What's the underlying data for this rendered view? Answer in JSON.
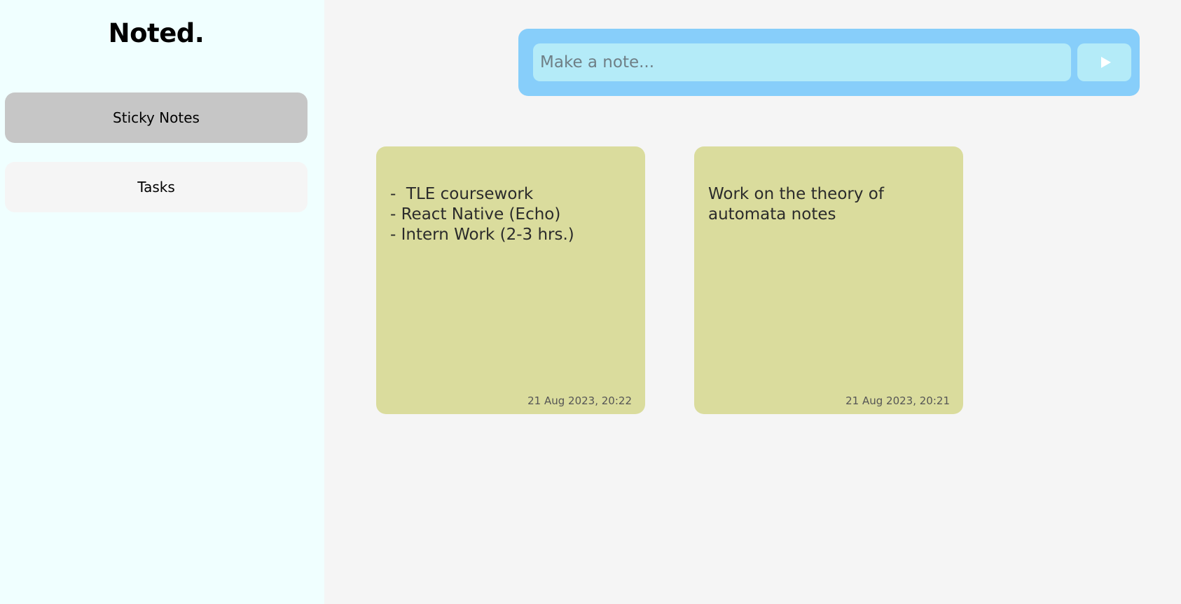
{
  "brand": {
    "title": "Noted."
  },
  "sidebar": {
    "items": [
      {
        "label": "Sticky Notes",
        "active": true
      },
      {
        "label": "Tasks",
        "active": false
      }
    ]
  },
  "composer": {
    "placeholder": "Make a note...",
    "value": "",
    "send_icon": "play-icon"
  },
  "notes": [
    {
      "text": "-  TLE coursework\n- React Native (Echo)\n- Intern Work (2-3 hrs.)",
      "timestamp": "21 Aug 2023, 20:22"
    },
    {
      "text": "Work on the theory of\nautomata notes",
      "timestamp": "21 Aug 2023, 20:21"
    }
  ],
  "colors": {
    "sidebar_bg": "#f0ffff",
    "main_bg": "#f5f5f5",
    "active_nav": "#c6c6c6",
    "composer_bg": "#87cefa",
    "input_bg": "#b4ebf8",
    "note_bg": "#dadc9d"
  }
}
